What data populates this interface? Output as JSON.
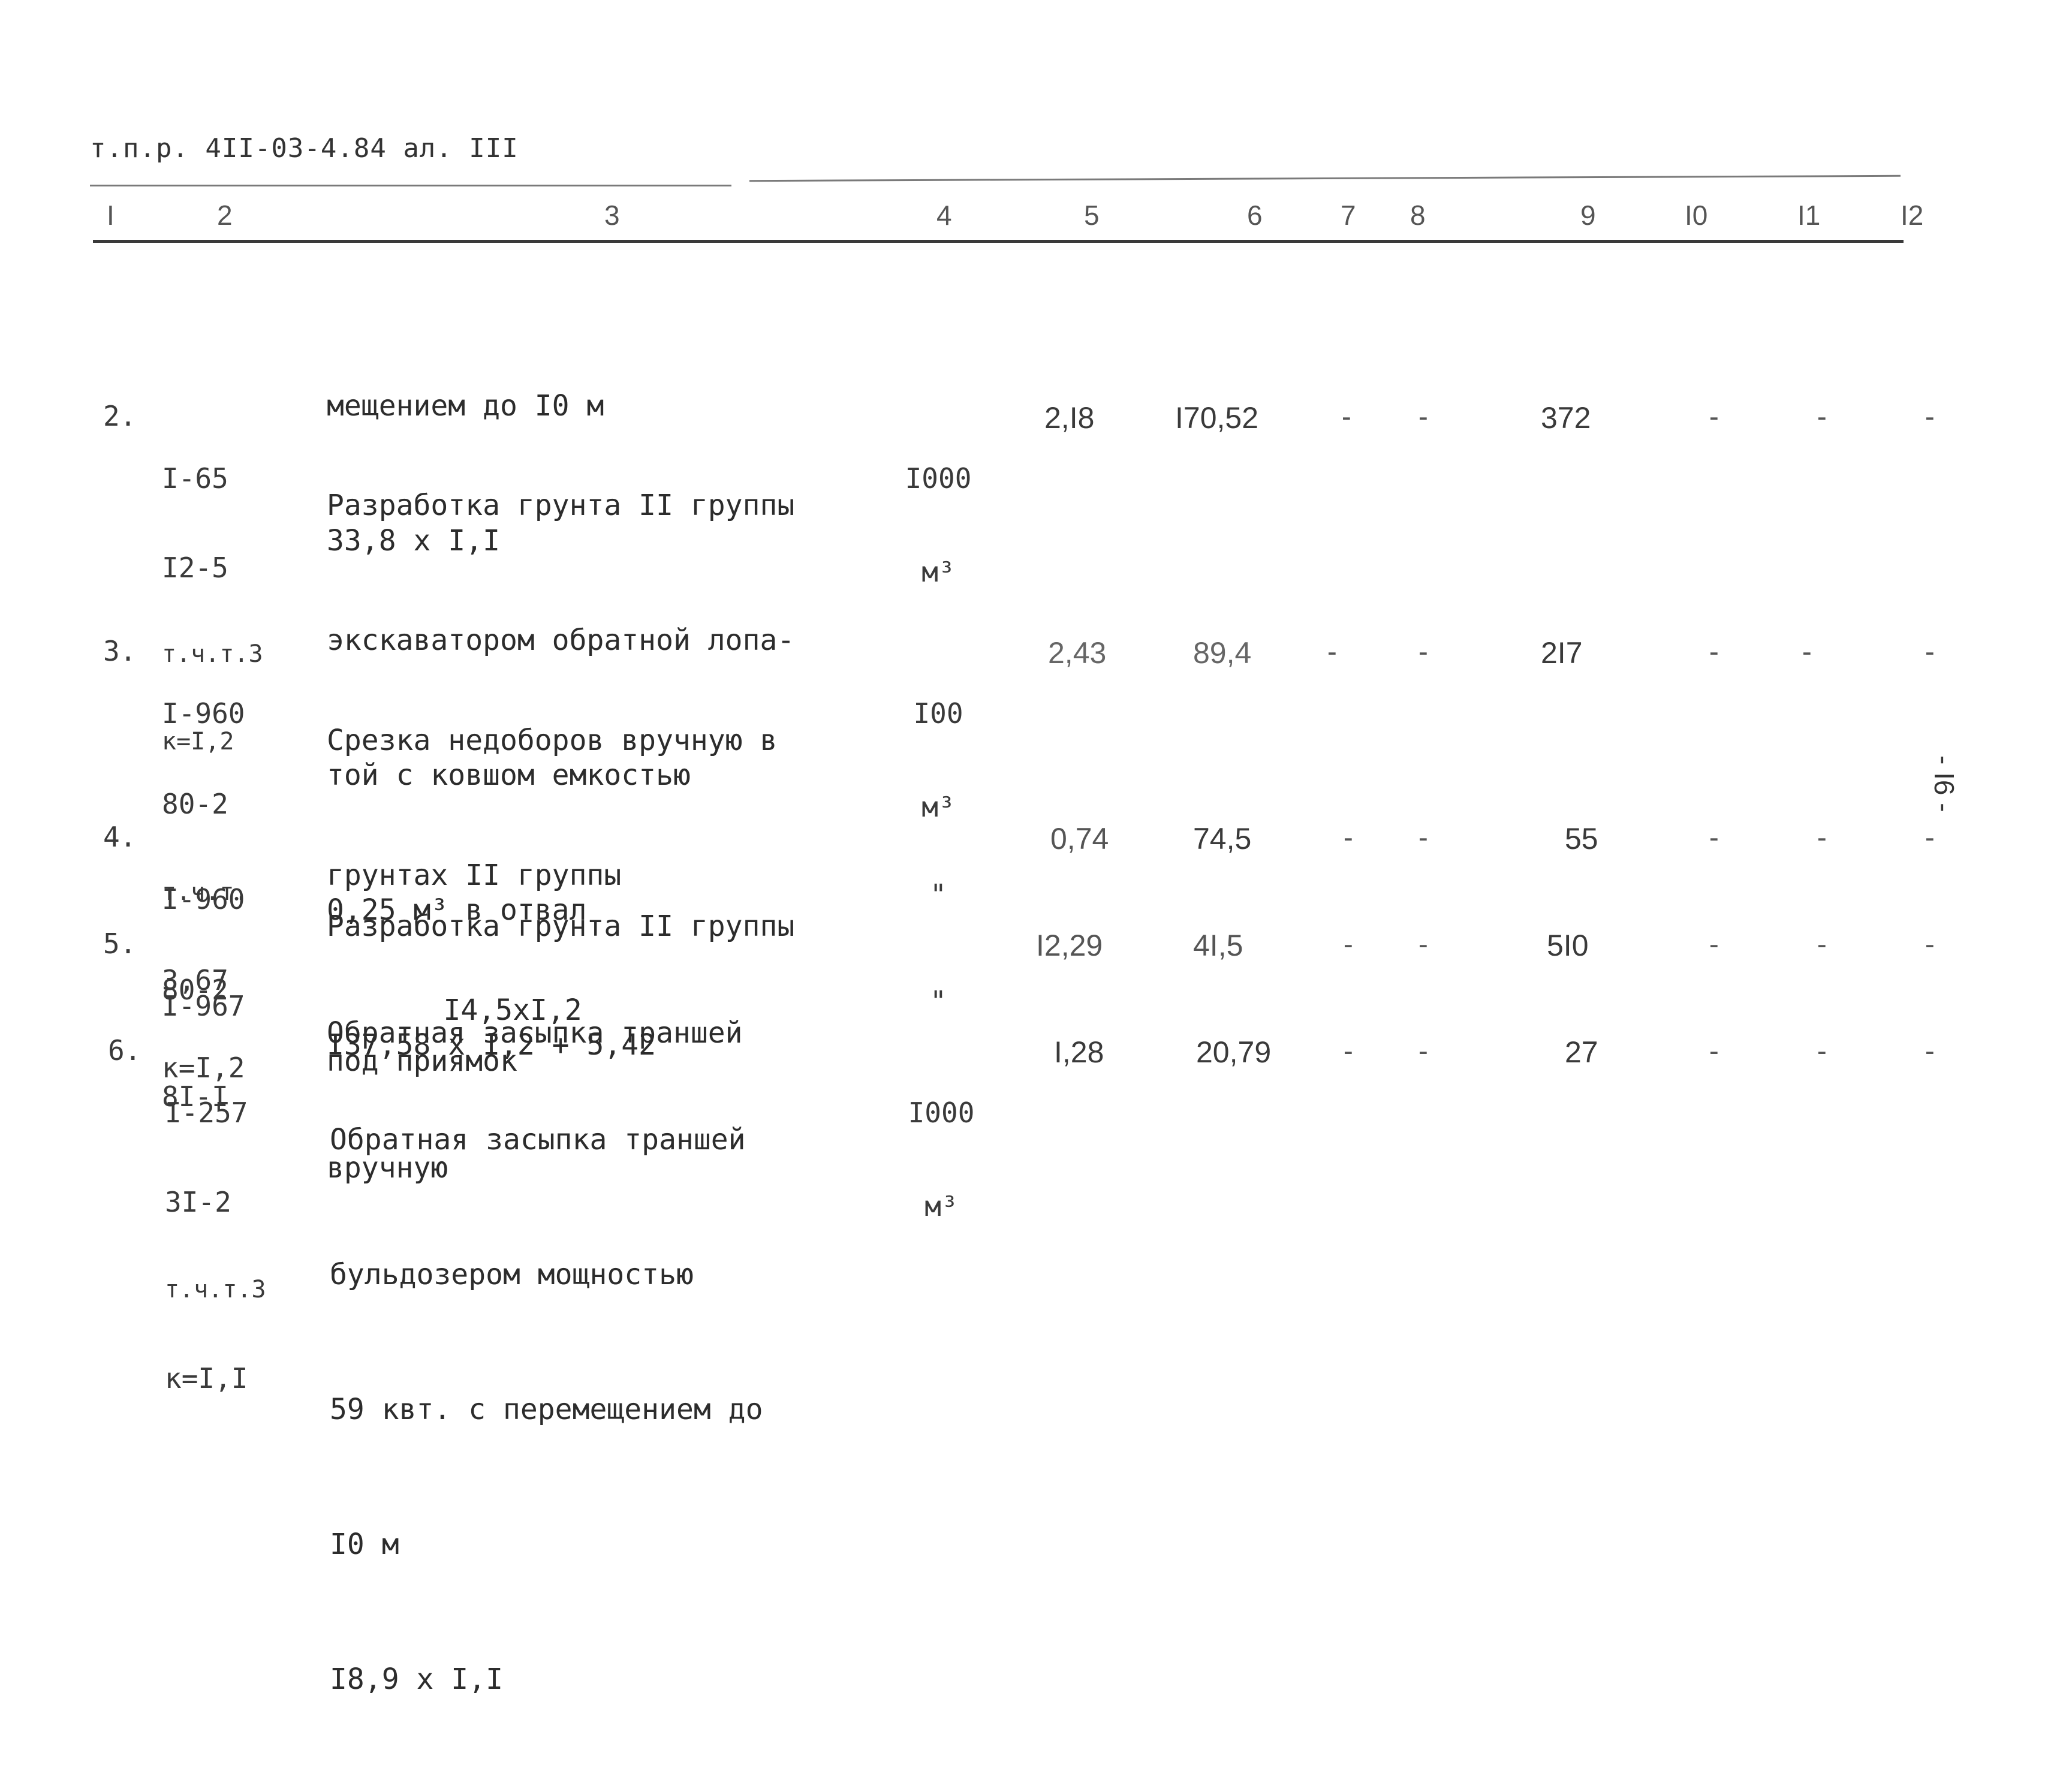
{
  "header": {
    "reference": "т.п.р. 4II-03-4.84 ал. III"
  },
  "columns": [
    "I",
    "2",
    "3",
    "4",
    "5",
    "6",
    "7",
    "8",
    "9",
    "I0",
    "I1",
    "I2"
  ],
  "continuation": {
    "lines": [
      "мещением до I0 м",
      "33,8 x I,I"
    ]
  },
  "rows": [
    {
      "no": "2.",
      "codes": [
        "I-65",
        "I2-5",
        "т.ч.т.3",
        "к=I,2"
      ],
      "description": [
        "Разработка грунта II группы",
        "экскаватором обратной лопа-",
        "той с ковшом емкостью",
        "0,25 м³ в отвал",
        "I37,58 x I,2 + 5,42"
      ],
      "unit": [
        "I000",
        "м³"
      ],
      "col5": "2,I8",
      "col6": "I70,52",
      "col7": "-",
      "col8": "-",
      "col9": "372",
      "col10": "-",
      "col11": "-",
      "col12": "-"
    },
    {
      "no": "3.",
      "codes": [
        "I-960",
        "80-2",
        "т.ч.т.",
        "3,67",
        "к=I,2"
      ],
      "description": [
        "Срезка недоборов вручную в",
        "грунтах II группы",
        "     I4,5xI,2"
      ],
      "unit": [
        "I00",
        "м³"
      ],
      "col5": "2,43",
      "col6": "89,4",
      "col7": "-",
      "col8": "-",
      "col9": "2I7",
      "col10": "-",
      "col11": "-",
      "col12": "-"
    },
    {
      "no": "4.",
      "codes": [
        "I-960",
        "80-2"
      ],
      "description": [
        "Разработка грунта II группы",
        "под приямок"
      ],
      "unit": [
        "\"",
        ""
      ],
      "col5": "0,74",
      "col6": "74,5",
      "col7": "-",
      "col8": "-",
      "col9": "55",
      "col10": "-",
      "col11": "-",
      "col12": "-"
    },
    {
      "no": "5.",
      "codes": [
        "I-967",
        "8I-I"
      ],
      "description": [
        "Обратная засыпка траншей",
        "вручную"
      ],
      "unit": [
        "\"",
        ""
      ],
      "col5": "I2,29",
      "col6": "4I,5",
      "col7": "-",
      "col8": "-",
      "col9": "5I0",
      "col10": "-",
      "col11": "-",
      "col12": "-"
    },
    {
      "no": "6.",
      "codes": [
        "I-257",
        "3I-2",
        "т.ч.т.3",
        "к=I,I"
      ],
      "description": [
        "Обратная засыпка траншей",
        "бульдозером мощностью",
        "59 квт. с перемещением до",
        "I0 м",
        "I8,9 x I,I"
      ],
      "unit": [
        "I000",
        "м³"
      ],
      "col5": "I,28",
      "col6": "20,79",
      "col7": "-",
      "col8": "-",
      "col9": "27",
      "col10": "-",
      "col11": "-",
      "col12": "-"
    }
  ],
  "page_number": "- I6 -"
}
